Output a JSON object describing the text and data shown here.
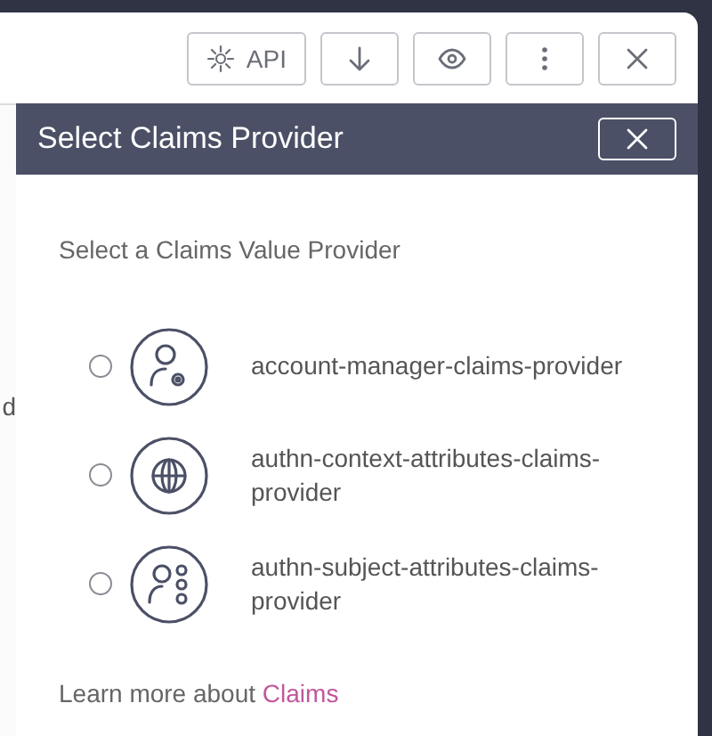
{
  "toolbar": {
    "buttons": [
      {
        "kind": "api",
        "label": "API"
      },
      {
        "kind": "download"
      },
      {
        "kind": "view"
      },
      {
        "kind": "more"
      },
      {
        "kind": "close"
      }
    ]
  },
  "background_page": {
    "text": "d"
  },
  "dialog": {
    "title": "Select Claims Provider",
    "prompt": "Select a Claims Value Provider",
    "options": [
      {
        "kind": "account",
        "label": "account-manager-claims-provider",
        "selected": false
      },
      {
        "kind": "globe",
        "label": "authn-context-attributes-claims-provider",
        "selected": false
      },
      {
        "kind": "subject",
        "label": "authn-subject-attributes-claims-provider",
        "selected": false
      }
    ],
    "footer": {
      "text": "Learn more about",
      "link": "Claims"
    }
  }
}
